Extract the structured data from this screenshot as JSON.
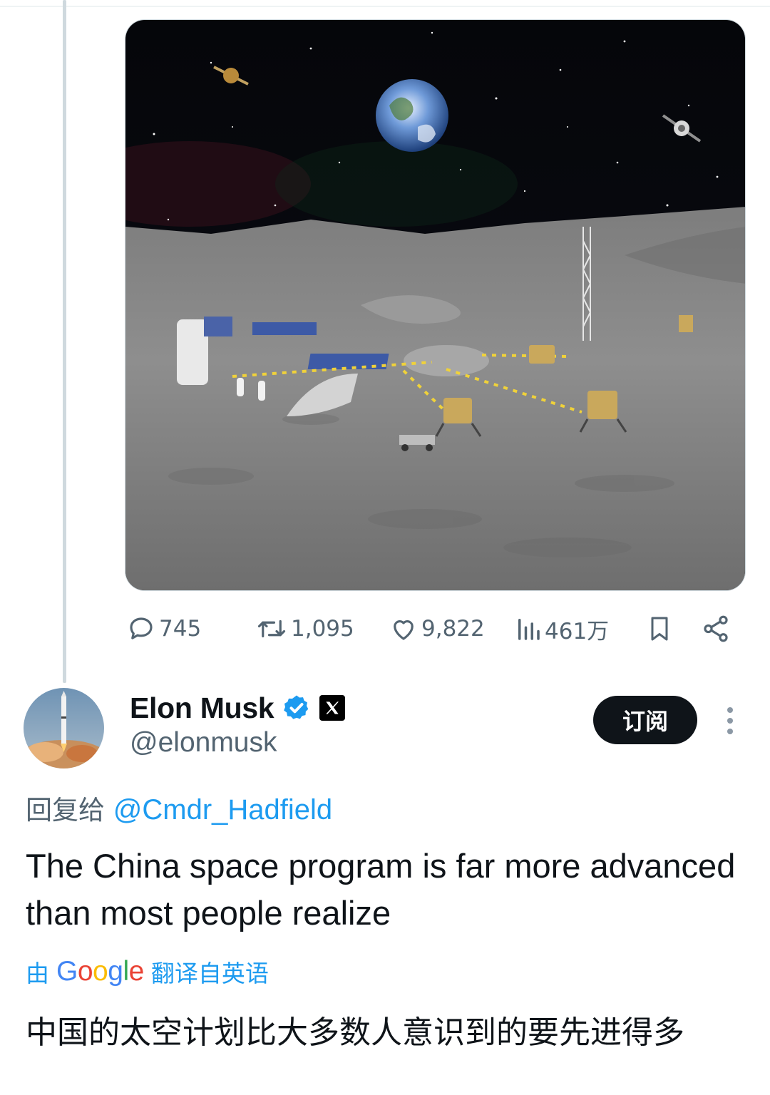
{
  "post_media": {
    "kind": "image",
    "scene": "lunar-base-rendering"
  },
  "actions": {
    "reply_count": "745",
    "retweet_count": "1,095",
    "like_count": "9,822",
    "view_count": "461万"
  },
  "author": {
    "display_name": "Elon Musk",
    "handle": "@elonmusk",
    "verified": true,
    "affiliation_badge": "X"
  },
  "subscribe_label": "订阅",
  "reply_to": {
    "prefix": "回复给",
    "mention": "@Cmdr_Hadfield"
  },
  "tweet": {
    "text": "The China space program is far more advanced than most people realize"
  },
  "translation": {
    "prefix": "由",
    "provider": "Google",
    "suffix": "翻译自英语",
    "text": "中国的太空计划比大多数人意识到的要先进得多"
  },
  "colors": {
    "link": "#1d9bf0",
    "secondary_text": "#536471",
    "primary_text": "#0f1419",
    "verified": "#1d9bf0"
  }
}
